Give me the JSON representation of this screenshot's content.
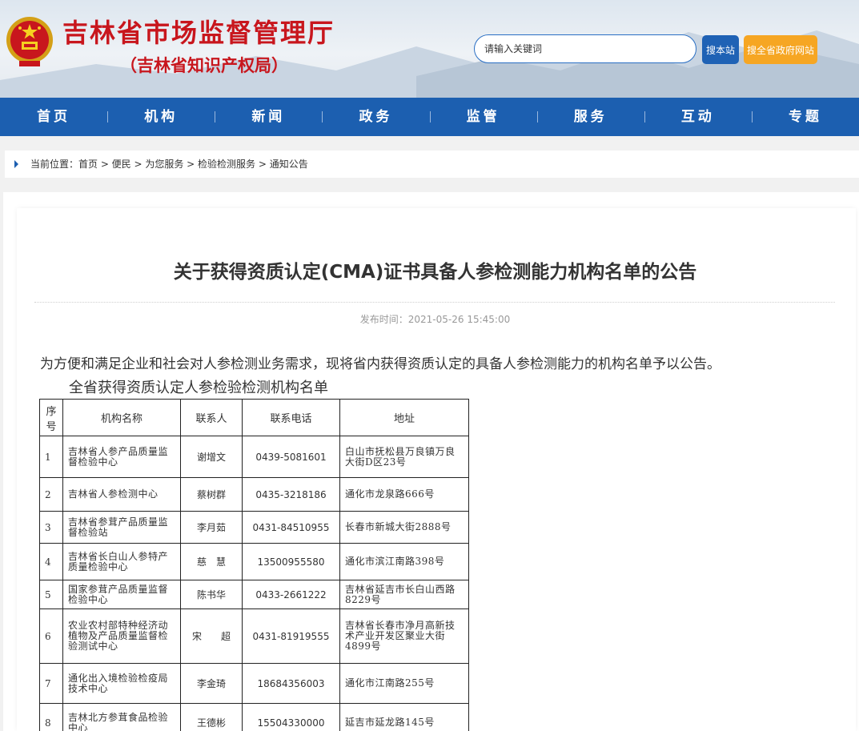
{
  "header": {
    "site_title": "吉林省市场监督管理厅",
    "site_subtitle": "（吉林省知识产权局）",
    "search_placeholder": "请输入关键词",
    "search_site_label": "搜本站",
    "search_all_label": "搜全省政府网站"
  },
  "nav": {
    "items": [
      "首页",
      "机构",
      "新闻",
      "政务",
      "监管",
      "服务",
      "互动",
      "专题"
    ]
  },
  "breadcrumb": {
    "text": "当前位置：首页 > 便民 > 为您服务 > 检验检测服务 > 通知公告"
  },
  "article": {
    "title": "关于获得资质认定(CMA)证书具备人参检测能力机构名单的公告",
    "publish_time": "发布时间：2021-05-26 15:45:00",
    "intro": "为方便和满足企业和社会对人参检测业务需求，现将省内获得资质认定的具备人参检测能力的机构名单予以公告。",
    "list_title": "全省获得资质认定人参检验检测机构名单"
  },
  "table": {
    "headers": [
      "序号",
      "机构名称",
      "联系人",
      "联系电话",
      "地址"
    ],
    "rows": [
      {
        "no": "1",
        "name": "吉林省人参产品质量监督检验中心",
        "contact": "谢增文",
        "phone": "0439-5081601",
        "address": "白山市抚松县万良镇万良大街D区23号"
      },
      {
        "no": "2",
        "name": "吉林省人参检测中心",
        "contact": "蔡树群",
        "phone": "0435-3218186",
        "address": "通化市龙泉路666号"
      },
      {
        "no": "3",
        "name": "吉林省参茸产品质量监督检验站",
        "contact": "李月茹",
        "phone": "0431-84510955",
        "address": "长春市新城大街2888号"
      },
      {
        "no": "4",
        "name": "吉林省长白山人参特产质量检验中心",
        "contact": "慈　慧",
        "phone": "13500955580",
        "address": "通化市滨江南路398号"
      },
      {
        "no": "5",
        "name": "国家参茸产品质量监督检验中心",
        "contact": "陈书华",
        "phone": "0433-2661222",
        "address": "吉林省延吉市长白山西路8229号"
      },
      {
        "no": "6",
        "name": "农业农村部特种经济动植物及产品质量监督检验测试中心",
        "contact": "宋　　超",
        "phone": "0431-81919555",
        "address": "吉林省长春市净月高新技术产业开发区聚业大街4899号"
      },
      {
        "no": "7",
        "name": "通化出入境检验检疫局技术中心",
        "contact": "李金琦",
        "phone": "18684356003",
        "address": "通化市江南路255号"
      },
      {
        "no": "8",
        "name": "吉林北方参茸食品检验中心",
        "contact": "王德彬",
        "phone": "15504330000",
        "address": "延吉市延龙路145号"
      }
    ]
  },
  "colors": {
    "nav_blue": "#1c5fb0",
    "title_red": "#c8161d",
    "search_orange": "#f6a623"
  }
}
